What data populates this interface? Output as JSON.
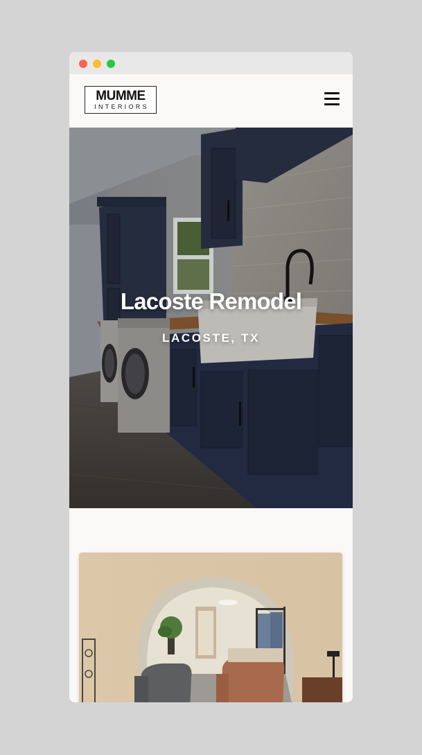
{
  "browser": {
    "controls": [
      "close",
      "minimize",
      "maximize"
    ]
  },
  "header": {
    "logo": {
      "line1": "MUMME",
      "line2": "INTERIORS"
    },
    "menu_icon": "hamburger-menu-icon"
  },
  "hero": {
    "title": "Lacoste Remodel",
    "subtitle": "LACOSTE, TX"
  },
  "gallery": {
    "items": [
      {
        "kind": "photo",
        "subject": "arched doorway living room"
      }
    ]
  },
  "colors": {
    "page_background": "#d4d4d4",
    "window_background": "#faf9f8",
    "cabinet_navy": "#2a3347",
    "hero_text": "#ffffff"
  }
}
